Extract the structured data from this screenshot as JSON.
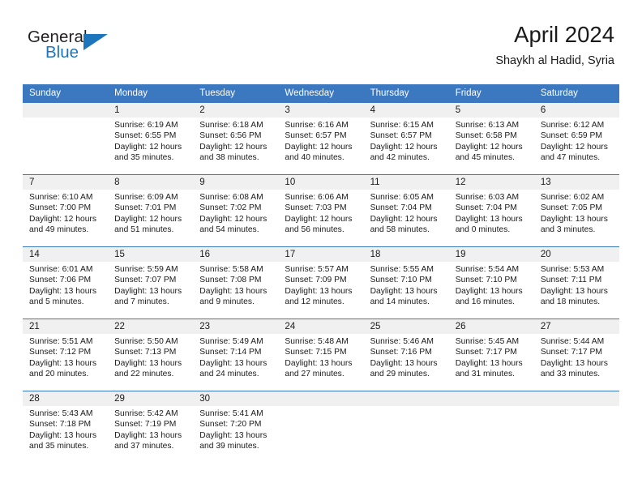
{
  "logo": {
    "word_one": "General",
    "word_two": "Blue",
    "mark": "triangle-icon",
    "brand_color": "#1d76bb"
  },
  "header": {
    "month_title": "April 2024",
    "location": "Shaykh al Hadid, Syria"
  },
  "theme": {
    "header_blue": "#3b78c0",
    "day_band_gray": "#f0f0f0",
    "text": "#1a1a1a"
  },
  "weekdays": [
    "Sunday",
    "Monday",
    "Tuesday",
    "Wednesday",
    "Thursday",
    "Friday",
    "Saturday"
  ],
  "weeks": [
    [
      {
        "day": "",
        "sunrise": "",
        "sunset": "",
        "daylight_line1": "",
        "daylight_line2": ""
      },
      {
        "day": "1",
        "sunrise": "Sunrise: 6:19 AM",
        "sunset": "Sunset: 6:55 PM",
        "daylight_line1": "Daylight: 12 hours",
        "daylight_line2": "and 35 minutes."
      },
      {
        "day": "2",
        "sunrise": "Sunrise: 6:18 AM",
        "sunset": "Sunset: 6:56 PM",
        "daylight_line1": "Daylight: 12 hours",
        "daylight_line2": "and 38 minutes."
      },
      {
        "day": "3",
        "sunrise": "Sunrise: 6:16 AM",
        "sunset": "Sunset: 6:57 PM",
        "daylight_line1": "Daylight: 12 hours",
        "daylight_line2": "and 40 minutes."
      },
      {
        "day": "4",
        "sunrise": "Sunrise: 6:15 AM",
        "sunset": "Sunset: 6:57 PM",
        "daylight_line1": "Daylight: 12 hours",
        "daylight_line2": "and 42 minutes."
      },
      {
        "day": "5",
        "sunrise": "Sunrise: 6:13 AM",
        "sunset": "Sunset: 6:58 PM",
        "daylight_line1": "Daylight: 12 hours",
        "daylight_line2": "and 45 minutes."
      },
      {
        "day": "6",
        "sunrise": "Sunrise: 6:12 AM",
        "sunset": "Sunset: 6:59 PM",
        "daylight_line1": "Daylight: 12 hours",
        "daylight_line2": "and 47 minutes."
      }
    ],
    [
      {
        "day": "7",
        "sunrise": "Sunrise: 6:10 AM",
        "sunset": "Sunset: 7:00 PM",
        "daylight_line1": "Daylight: 12 hours",
        "daylight_line2": "and 49 minutes."
      },
      {
        "day": "8",
        "sunrise": "Sunrise: 6:09 AM",
        "sunset": "Sunset: 7:01 PM",
        "daylight_line1": "Daylight: 12 hours",
        "daylight_line2": "and 51 minutes."
      },
      {
        "day": "9",
        "sunrise": "Sunrise: 6:08 AM",
        "sunset": "Sunset: 7:02 PM",
        "daylight_line1": "Daylight: 12 hours",
        "daylight_line2": "and 54 minutes."
      },
      {
        "day": "10",
        "sunrise": "Sunrise: 6:06 AM",
        "sunset": "Sunset: 7:03 PM",
        "daylight_line1": "Daylight: 12 hours",
        "daylight_line2": "and 56 minutes."
      },
      {
        "day": "11",
        "sunrise": "Sunrise: 6:05 AM",
        "sunset": "Sunset: 7:04 PM",
        "daylight_line1": "Daylight: 12 hours",
        "daylight_line2": "and 58 minutes."
      },
      {
        "day": "12",
        "sunrise": "Sunrise: 6:03 AM",
        "sunset": "Sunset: 7:04 PM",
        "daylight_line1": "Daylight: 13 hours",
        "daylight_line2": "and 0 minutes."
      },
      {
        "day": "13",
        "sunrise": "Sunrise: 6:02 AM",
        "sunset": "Sunset: 7:05 PM",
        "daylight_line1": "Daylight: 13 hours",
        "daylight_line2": "and 3 minutes."
      }
    ],
    [
      {
        "day": "14",
        "sunrise": "Sunrise: 6:01 AM",
        "sunset": "Sunset: 7:06 PM",
        "daylight_line1": "Daylight: 13 hours",
        "daylight_line2": "and 5 minutes."
      },
      {
        "day": "15",
        "sunrise": "Sunrise: 5:59 AM",
        "sunset": "Sunset: 7:07 PM",
        "daylight_line1": "Daylight: 13 hours",
        "daylight_line2": "and 7 minutes."
      },
      {
        "day": "16",
        "sunrise": "Sunrise: 5:58 AM",
        "sunset": "Sunset: 7:08 PM",
        "daylight_line1": "Daylight: 13 hours",
        "daylight_line2": "and 9 minutes."
      },
      {
        "day": "17",
        "sunrise": "Sunrise: 5:57 AM",
        "sunset": "Sunset: 7:09 PM",
        "daylight_line1": "Daylight: 13 hours",
        "daylight_line2": "and 12 minutes."
      },
      {
        "day": "18",
        "sunrise": "Sunrise: 5:55 AM",
        "sunset": "Sunset: 7:10 PM",
        "daylight_line1": "Daylight: 13 hours",
        "daylight_line2": "and 14 minutes."
      },
      {
        "day": "19",
        "sunrise": "Sunrise: 5:54 AM",
        "sunset": "Sunset: 7:10 PM",
        "daylight_line1": "Daylight: 13 hours",
        "daylight_line2": "and 16 minutes."
      },
      {
        "day": "20",
        "sunrise": "Sunrise: 5:53 AM",
        "sunset": "Sunset: 7:11 PM",
        "daylight_line1": "Daylight: 13 hours",
        "daylight_line2": "and 18 minutes."
      }
    ],
    [
      {
        "day": "21",
        "sunrise": "Sunrise: 5:51 AM",
        "sunset": "Sunset: 7:12 PM",
        "daylight_line1": "Daylight: 13 hours",
        "daylight_line2": "and 20 minutes."
      },
      {
        "day": "22",
        "sunrise": "Sunrise: 5:50 AM",
        "sunset": "Sunset: 7:13 PM",
        "daylight_line1": "Daylight: 13 hours",
        "daylight_line2": "and 22 minutes."
      },
      {
        "day": "23",
        "sunrise": "Sunrise: 5:49 AM",
        "sunset": "Sunset: 7:14 PM",
        "daylight_line1": "Daylight: 13 hours",
        "daylight_line2": "and 24 minutes."
      },
      {
        "day": "24",
        "sunrise": "Sunrise: 5:48 AM",
        "sunset": "Sunset: 7:15 PM",
        "daylight_line1": "Daylight: 13 hours",
        "daylight_line2": "and 27 minutes."
      },
      {
        "day": "25",
        "sunrise": "Sunrise: 5:46 AM",
        "sunset": "Sunset: 7:16 PM",
        "daylight_line1": "Daylight: 13 hours",
        "daylight_line2": "and 29 minutes."
      },
      {
        "day": "26",
        "sunrise": "Sunrise: 5:45 AM",
        "sunset": "Sunset: 7:17 PM",
        "daylight_line1": "Daylight: 13 hours",
        "daylight_line2": "and 31 minutes."
      },
      {
        "day": "27",
        "sunrise": "Sunrise: 5:44 AM",
        "sunset": "Sunset: 7:17 PM",
        "daylight_line1": "Daylight: 13 hours",
        "daylight_line2": "and 33 minutes."
      }
    ],
    [
      {
        "day": "28",
        "sunrise": "Sunrise: 5:43 AM",
        "sunset": "Sunset: 7:18 PM",
        "daylight_line1": "Daylight: 13 hours",
        "daylight_line2": "and 35 minutes."
      },
      {
        "day": "29",
        "sunrise": "Sunrise: 5:42 AM",
        "sunset": "Sunset: 7:19 PM",
        "daylight_line1": "Daylight: 13 hours",
        "daylight_line2": "and 37 minutes."
      },
      {
        "day": "30",
        "sunrise": "Sunrise: 5:41 AM",
        "sunset": "Sunset: 7:20 PM",
        "daylight_line1": "Daylight: 13 hours",
        "daylight_line2": "and 39 minutes."
      },
      {
        "day": "",
        "sunrise": "",
        "sunset": "",
        "daylight_line1": "",
        "daylight_line2": ""
      },
      {
        "day": "",
        "sunrise": "",
        "sunset": "",
        "daylight_line1": "",
        "daylight_line2": ""
      },
      {
        "day": "",
        "sunrise": "",
        "sunset": "",
        "daylight_line1": "",
        "daylight_line2": ""
      },
      {
        "day": "",
        "sunrise": "",
        "sunset": "",
        "daylight_line1": "",
        "daylight_line2": ""
      }
    ]
  ]
}
